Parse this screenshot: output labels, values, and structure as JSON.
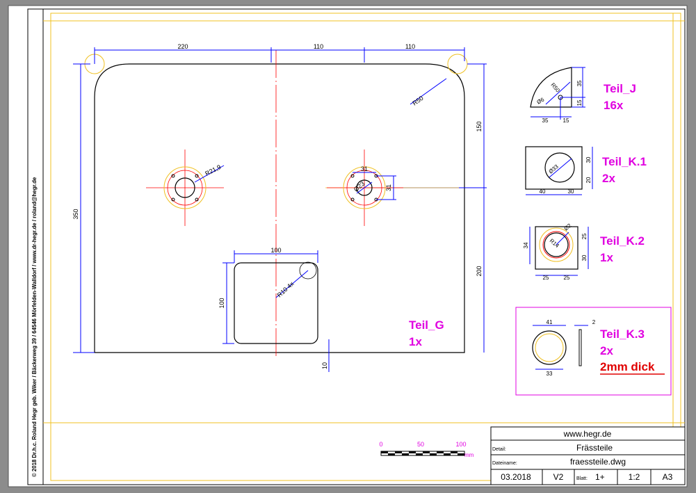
{
  "side_text": "© 2018   Dr.h.c. Roland Hegr geb. Wiker / Bäckerweg 39 / 64546 Mörfelden-Walldorf / www.dr-hegr.de / roland@hegr.de",
  "main_part": {
    "dims": {
      "top_a": "220",
      "top_b": "110",
      "top_c": "110",
      "left": "350",
      "right_upper": "150",
      "right_lower": "200",
      "bottom": "10",
      "corner_radius": "R50"
    },
    "left_hole_radius": "R21,9",
    "right_hole_dims": {
      "width": "31",
      "height": "31",
      "diameter": "Ø23"
    },
    "cutout": {
      "width": "100",
      "height": "100",
      "radius": "R10 4x"
    },
    "name": "Teil_G",
    "qty": "1x"
  },
  "parts": [
    {
      "name": "Teil_J",
      "qty": "16x",
      "dims": [
        "35",
        "15",
        "35",
        "15",
        "R50",
        "Ø6"
      ]
    },
    {
      "name": "Teil_K.1",
      "qty": "2x",
      "dims": [
        "40",
        "30",
        "30",
        "20",
        "Ø33"
      ]
    },
    {
      "name": "Teil_K.2",
      "qty": "1x",
      "dims": [
        "34",
        "25",
        "30",
        "25",
        "25",
        "R14",
        "Ø2"
      ]
    },
    {
      "name": "Teil_K.3",
      "qty": "2x",
      "note": "2mm dick",
      "dims": [
        "41",
        "33",
        "2"
      ]
    }
  ],
  "scale_bar": {
    "labels": [
      "0",
      "50",
      "100"
    ],
    "unit": "mm"
  },
  "title_block": {
    "website": "www.hegr.de",
    "detail_label": "Detail:",
    "detail_value": "Frässteile",
    "file_label": "Dateiname:",
    "file_value": "fraessteile.dwg",
    "date": "03.2018",
    "version": "V2",
    "sheet_label": "Blatt:",
    "sheet_value": "1+",
    "scale": "1:2",
    "format": "A3"
  },
  "colors": {
    "frame": "#f0c020",
    "outline": "#000000",
    "dimension": "#0000ff",
    "centerline": "#ff0000",
    "label": "#e000e0",
    "note": "#e00000"
  }
}
